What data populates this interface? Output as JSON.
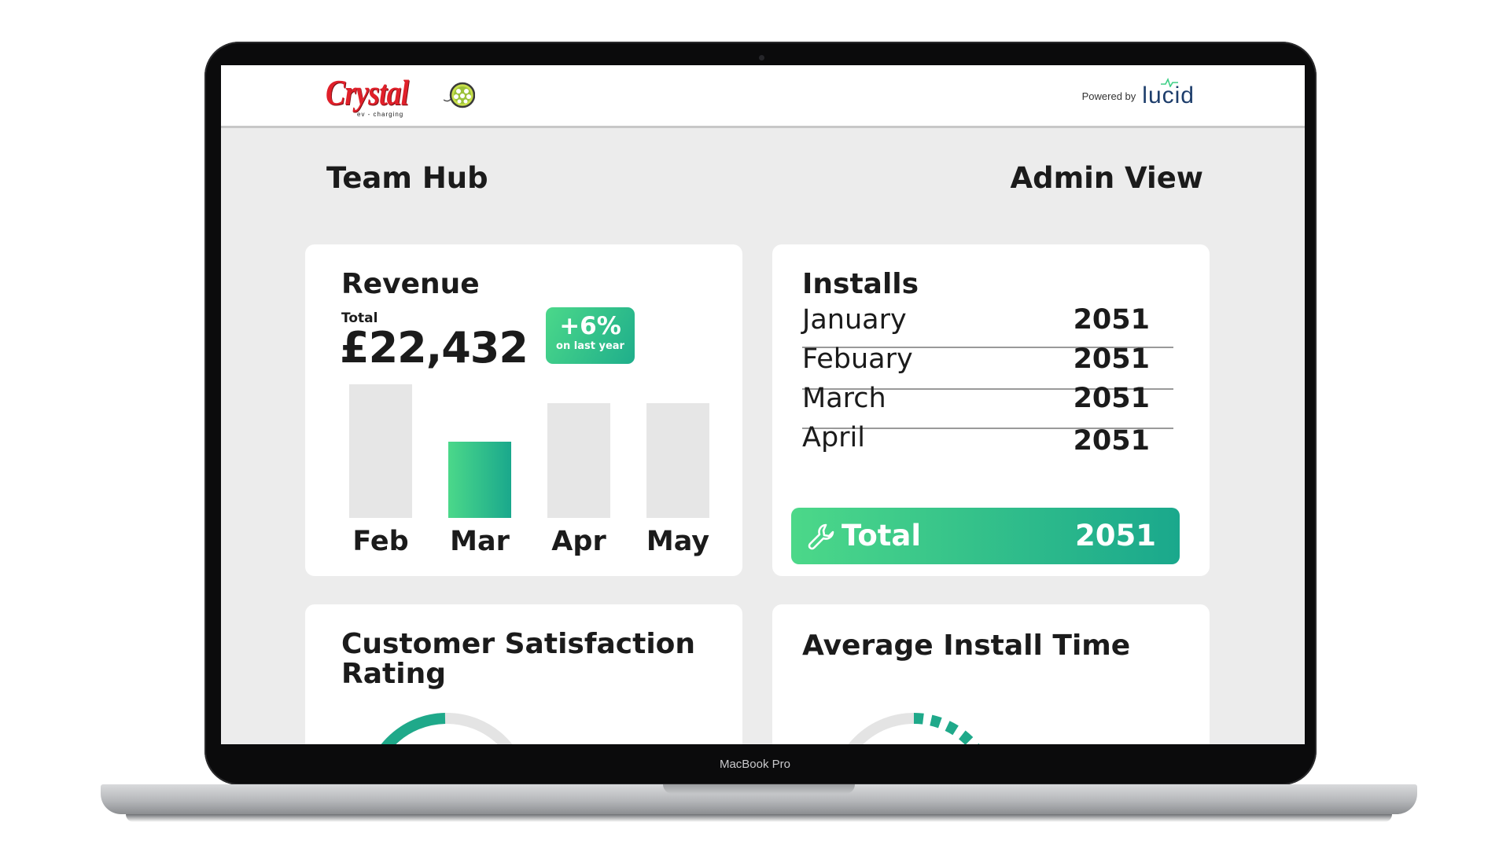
{
  "header": {
    "brand_name": "Crystal",
    "brand_tagline": "ev - charging",
    "powered_by_label": "Powered by",
    "powered_by_brand": "lucid"
  },
  "page": {
    "title": "Team Hub",
    "view": "Admin View"
  },
  "revenue": {
    "title": "Revenue",
    "total_label": "Total",
    "total_value": "£22,432",
    "growth_value": "+6%",
    "growth_caption": "on last year",
    "bars": [
      {
        "label": "Feb",
        "relative_height": 1.0,
        "highlight": false
      },
      {
        "label": "Mar",
        "relative_height": 0.57,
        "highlight": true
      },
      {
        "label": "Apr",
        "relative_height": 0.86,
        "highlight": false
      },
      {
        "label": "May",
        "relative_height": 0.86,
        "highlight": false
      }
    ]
  },
  "installs": {
    "title": "Installs",
    "rows": [
      {
        "month": "January",
        "value": "2051"
      },
      {
        "month": "Febuary",
        "value": "2051"
      },
      {
        "month": "March",
        "value": "2051"
      },
      {
        "month": "April",
        "value": "2051"
      }
    ],
    "total_label": "Total",
    "total_value": "2051"
  },
  "satisfaction": {
    "title_line1": "Customer Satisfaction",
    "title_line2": "Rating"
  },
  "install_time": {
    "title": "Average Install Time"
  },
  "device": {
    "label": "MacBook Pro"
  },
  "colors": {
    "accent_start": "#4bd88a",
    "accent_end": "#1aa88c",
    "brand_red": "#e0202a",
    "bar_gray": "#e6e6e6",
    "page_bg": "#ececec"
  },
  "icons": {
    "total": "wrench-icon",
    "brand": "ev-plug-icon"
  }
}
